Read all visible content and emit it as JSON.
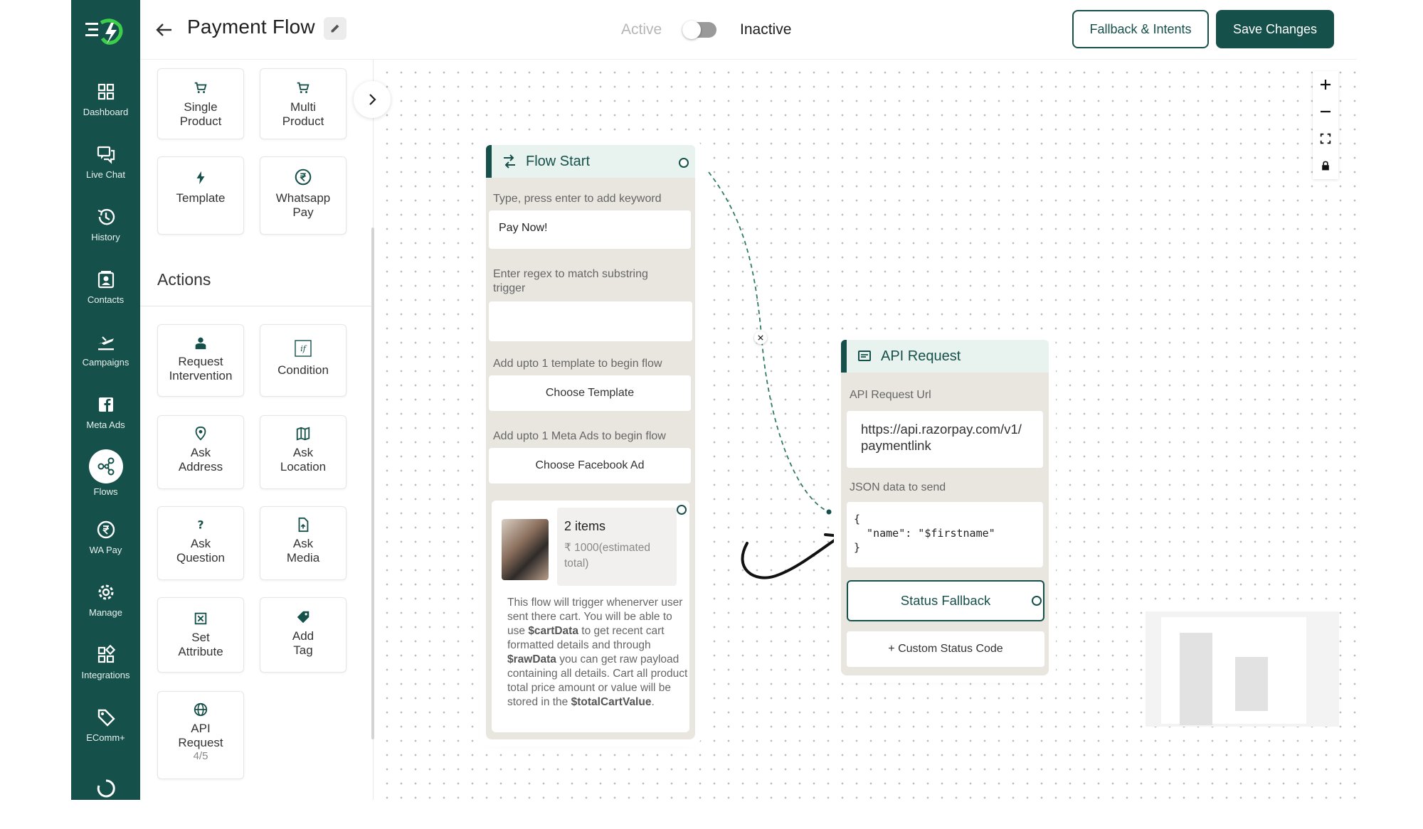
{
  "header": {
    "title": "Payment Flow",
    "status_active": "Active",
    "status_inactive": "Inactive",
    "fallback_button": "Fallback & Intents",
    "save_button": "Save Changes"
  },
  "sidebar": {
    "items": [
      {
        "label": "Dashboard",
        "icon": "dashboard-icon"
      },
      {
        "label": "Live Chat",
        "icon": "chat-icon"
      },
      {
        "label": "History",
        "icon": "history-icon"
      },
      {
        "label": "Contacts",
        "icon": "contacts-icon"
      },
      {
        "label": "Campaigns",
        "icon": "plane-icon"
      },
      {
        "label": "Meta Ads",
        "icon": "facebook-icon"
      },
      {
        "label": "Flows",
        "icon": "flows-icon",
        "active": true
      },
      {
        "label": "WA Pay",
        "icon": "rupee-icon"
      },
      {
        "label": "Manage",
        "icon": "gear-icon"
      },
      {
        "label": "Integrations",
        "icon": "integrations-icon"
      },
      {
        "label": "EComm+",
        "icon": "tag-icon"
      }
    ]
  },
  "palette": {
    "messages": [
      {
        "label": "Single\nProduct",
        "l1": "Single",
        "l2": "Product",
        "icon": "cart-icon"
      },
      {
        "label": "Multi\nProduct",
        "l1": "Multi",
        "l2": "Product",
        "icon": "cart-icon"
      },
      {
        "l1": "Template",
        "icon": "bolt-icon"
      },
      {
        "l1": "Whatsapp",
        "l2": "Pay",
        "icon": "rupee-icon"
      }
    ],
    "actions_title": "Actions",
    "actions": [
      {
        "l1": "Request",
        "l2": "Intervention",
        "icon": "agent-icon"
      },
      {
        "l1": "Condition",
        "icon": "if-icon"
      },
      {
        "l1": "Ask",
        "l2": "Address",
        "icon": "pin-icon"
      },
      {
        "l1": "Ask",
        "l2": "Location",
        "icon": "map-icon"
      },
      {
        "l1": "Ask",
        "l2": "Question",
        "icon": "question-icon"
      },
      {
        "l1": "Ask",
        "l2": "Media",
        "icon": "file-icon"
      },
      {
        "l1": "Set",
        "l2": "Attribute",
        "icon": "attribute-icon"
      },
      {
        "l1": "Add",
        "l2": "Tag",
        "icon": "tag-icon"
      },
      {
        "l1": "API",
        "l2": "Request",
        "sub": "4/5",
        "icon": "globe-icon"
      }
    ]
  },
  "flow_start": {
    "title": "Flow Start",
    "keyword_label": "Type, press enter to add keyword",
    "keyword_value": "Pay Now!",
    "regex_label": "Enter regex to match substring trigger",
    "regex_value": "",
    "template_label": "Add upto 1 template to begin flow",
    "template_button": "Choose Template",
    "meta_label": "Add upto 1 Meta Ads to begin flow",
    "meta_button": "Choose Facebook Ad",
    "cart": {
      "items": "2 items",
      "total": "₹ 1000(estimated total)",
      "desc_1": "This flow will trigger whenerver user sent there cart. You will be able to use ",
      "var_cart": "$cartData",
      "desc_2": " to get recent cart formatted details and through ",
      "var_raw": "$rawData",
      "desc_3": " you can get raw payload containing all details. Cart all product total price amount or value will be stored in the ",
      "var_total": "$totalCartValue",
      "desc_4": "."
    }
  },
  "api_request": {
    "title": "API Request",
    "url_label": "API Request Url",
    "url_value": "https://api.razorpay.com/v1/paymentlink",
    "json_label": "JSON data to send",
    "json_value": "{\n  \"name\": \"$firstname\"\n}",
    "status_fallback": "Status Fallback",
    "custom_status": "+ Custom Status Code"
  },
  "colors": {
    "brand": "#16504a",
    "node_bg": "#e9e6e0",
    "header_bg": "#e8f3ef"
  }
}
